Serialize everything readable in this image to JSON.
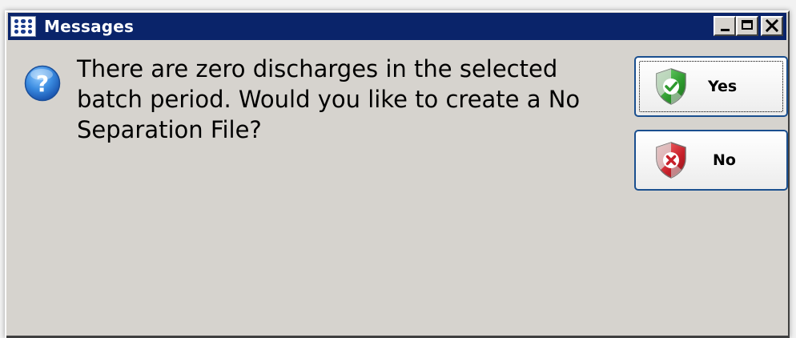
{
  "window": {
    "title": "Messages",
    "icon": "app-grid-icon",
    "controls": [
      "minimize-icon",
      "maximize-icon",
      "close-icon"
    ]
  },
  "dialog": {
    "icon": "question-icon",
    "message": "There are zero discharges in the selected batch period. Would you like to create a No Separation File?"
  },
  "buttons": {
    "yes": {
      "label": "Yes",
      "icon": "shield-check-icon",
      "icon_color": "#2e9a2e"
    },
    "no": {
      "label": "No",
      "icon": "shield-x-icon",
      "icon_color": "#c8202a"
    }
  },
  "colors": {
    "titlebar": "#0a246a",
    "window_bg": "#d6d3ce",
    "button_border": "#1a4f8f"
  }
}
